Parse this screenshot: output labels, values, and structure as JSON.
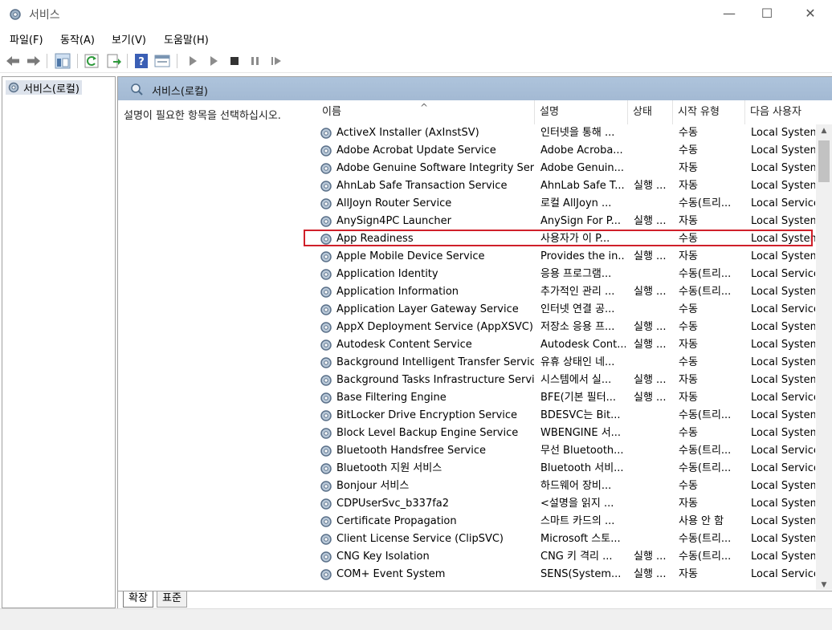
{
  "window": {
    "title": "서비스",
    "minimize": "—",
    "maximize": "☐",
    "close": "✕",
    "icon": "gear-icon"
  },
  "menu": [
    "파일(F)",
    "동작(A)",
    "보기(V)",
    "도움말(H)"
  ],
  "toolbar": {
    "icons": [
      "back-arrow-icon",
      "forward-arrow-icon",
      "show-hide-tree-icon",
      "refresh-icon",
      "export-list-icon",
      "help-icon",
      "properties-icon",
      "start-icon",
      "start-alt-icon",
      "stop-icon",
      "pause-icon",
      "resume-icon"
    ]
  },
  "tree": {
    "root_label": "서비스(로컬)"
  },
  "panel": {
    "title": "서비스(로컬)",
    "description": "설명이 필요한 항목을 선택하십시오."
  },
  "columns": {
    "name": "이름",
    "description": "설명",
    "status": "상태",
    "startup": "시작 유형",
    "logon": "다음 사용자"
  },
  "services": [
    {
      "name": "ActiveX Installer (AxInstSV)",
      "description": "인터넷을 통해 ...",
      "status": "",
      "startup": "수동",
      "logon": "Local System"
    },
    {
      "name": "Adobe Acrobat Update Service",
      "description": "Adobe Acroba...",
      "status": "",
      "startup": "수동",
      "logon": "Local System"
    },
    {
      "name": "Adobe Genuine Software Integrity Service",
      "description": "Adobe Genuin...",
      "status": "",
      "startup": "자동",
      "logon": "Local System"
    },
    {
      "name": "AhnLab Safe Transaction Service",
      "description": "AhnLab Safe T...",
      "status": "실행 ...",
      "startup": "자동",
      "logon": "Local System"
    },
    {
      "name": "AllJoyn Router Service",
      "description": "로컬 AllJoyn ...",
      "status": "",
      "startup": "수동(트리...",
      "logon": "Local Service"
    },
    {
      "name": "AnySign4PC Launcher",
      "description": "AnySign For P...",
      "status": "실행 ...",
      "startup": "자동",
      "logon": "Local System"
    },
    {
      "name": "App Readiness",
      "description": "사용자가 이 P...",
      "status": "",
      "startup": "수동",
      "logon": "Local System"
    },
    {
      "name": "Apple Mobile Device Service",
      "description": "Provides the in...",
      "status": "실행 ...",
      "startup": "자동",
      "logon": "Local System"
    },
    {
      "name": "Application Identity",
      "description": "응용 프로그램...",
      "status": "",
      "startup": "수동(트리...",
      "logon": "Local Service"
    },
    {
      "name": "Application Information",
      "description": "추가적인 관리 ...",
      "status": "실행 ...",
      "startup": "수동(트리...",
      "logon": "Local System"
    },
    {
      "name": "Application Layer Gateway Service",
      "description": "인터넷 연결 공...",
      "status": "",
      "startup": "수동",
      "logon": "Local Service"
    },
    {
      "name": "AppX Deployment Service (AppXSVC)",
      "description": "저장소 응용 프...",
      "status": "실행 ...",
      "startup": "수동",
      "logon": "Local System"
    },
    {
      "name": "Autodesk Content Service",
      "description": "Autodesk Cont...",
      "status": "실행 ...",
      "startup": "자동",
      "logon": "Local System"
    },
    {
      "name": "Background Intelligent Transfer Service",
      "description": "유휴 상태인 네...",
      "status": "",
      "startup": "수동",
      "logon": "Local System"
    },
    {
      "name": "Background Tasks Infrastructure Service",
      "description": "시스템에서 실...",
      "status": "실행 ...",
      "startup": "자동",
      "logon": "Local System"
    },
    {
      "name": "Base Filtering Engine",
      "description": "BFE(기본 필터...",
      "status": "실행 ...",
      "startup": "자동",
      "logon": "Local Service"
    },
    {
      "name": "BitLocker Drive Encryption Service",
      "description": "BDESVC는 Bit...",
      "status": "",
      "startup": "수동(트리...",
      "logon": "Local System"
    },
    {
      "name": "Block Level Backup Engine Service",
      "description": "WBENGINE 서...",
      "status": "",
      "startup": "수동",
      "logon": "Local System"
    },
    {
      "name": "Bluetooth Handsfree Service",
      "description": "무선 Bluetooth...",
      "status": "",
      "startup": "수동(트리...",
      "logon": "Local Service"
    },
    {
      "name": "Bluetooth 지원 서비스",
      "description": "Bluetooth 서비...",
      "status": "",
      "startup": "수동(트리...",
      "logon": "Local Service"
    },
    {
      "name": "Bonjour 서비스",
      "description": "하드웨어 장비...",
      "status": "",
      "startup": "수동",
      "logon": "Local System"
    },
    {
      "name": "CDPUserSvc_b337fa2",
      "description": "<설명을 읽지 ...",
      "status": "",
      "startup": "자동",
      "logon": "Local System"
    },
    {
      "name": "Certificate Propagation",
      "description": "스마트 카드의 ...",
      "status": "",
      "startup": "사용 안 함",
      "logon": "Local System"
    },
    {
      "name": "Client License Service (ClipSVC)",
      "description": "Microsoft 스토...",
      "status": "",
      "startup": "수동(트리...",
      "logon": "Local System"
    },
    {
      "name": "CNG Key Isolation",
      "description": "CNG 키 격리 ...",
      "status": "실행 ...",
      "startup": "수동(트리...",
      "logon": "Local System"
    },
    {
      "name": "COM+ Event System",
      "description": "SENS(System...",
      "status": "실행 ...",
      "startup": "자동",
      "logon": "Local Service"
    }
  ],
  "tabs": [
    "확장",
    "표준"
  ],
  "highlight_color": "#d0202a"
}
